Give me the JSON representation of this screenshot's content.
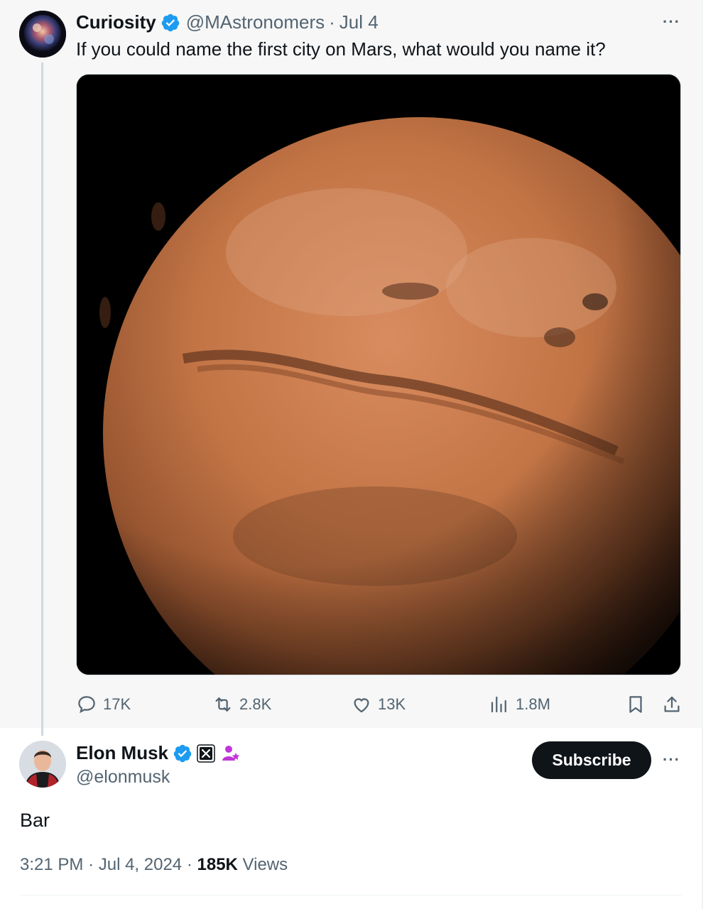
{
  "quoted_tweet": {
    "author_name": "Curiosity",
    "handle": "@MAstronomers",
    "separator": "·",
    "date": "Jul 4",
    "text": "If you could name the first city on Mars, what would you name it?",
    "more_label": "···",
    "metrics": {
      "replies": "17K",
      "reposts": "2.8K",
      "likes": "13K",
      "views": "1.8M"
    }
  },
  "reply_tweet": {
    "author_name": "Elon Musk",
    "handle": "@elonmusk",
    "subscribe_label": "Subscribe",
    "more_label": "···",
    "text": "Bar",
    "time": "3:21 PM",
    "separator": "·",
    "date": "Jul 4, 2024",
    "views_count": "185K",
    "views_label": "Views"
  },
  "icons": {
    "verified": "verified-badge-icon",
    "affiliate": "x-affiliate-badge-icon",
    "subscriber": "subscriber-badge-icon",
    "reply": "reply-icon",
    "repost": "repost-icon",
    "like": "like-icon",
    "views": "views-icon",
    "bookmark": "bookmark-icon",
    "share": "share-icon"
  },
  "colors": {
    "verified_blue": "#1d9bf0",
    "text_primary": "#0f1419",
    "text_secondary": "#536471",
    "subscriber_badge": "#c136d8",
    "mars": "#b8663a"
  }
}
